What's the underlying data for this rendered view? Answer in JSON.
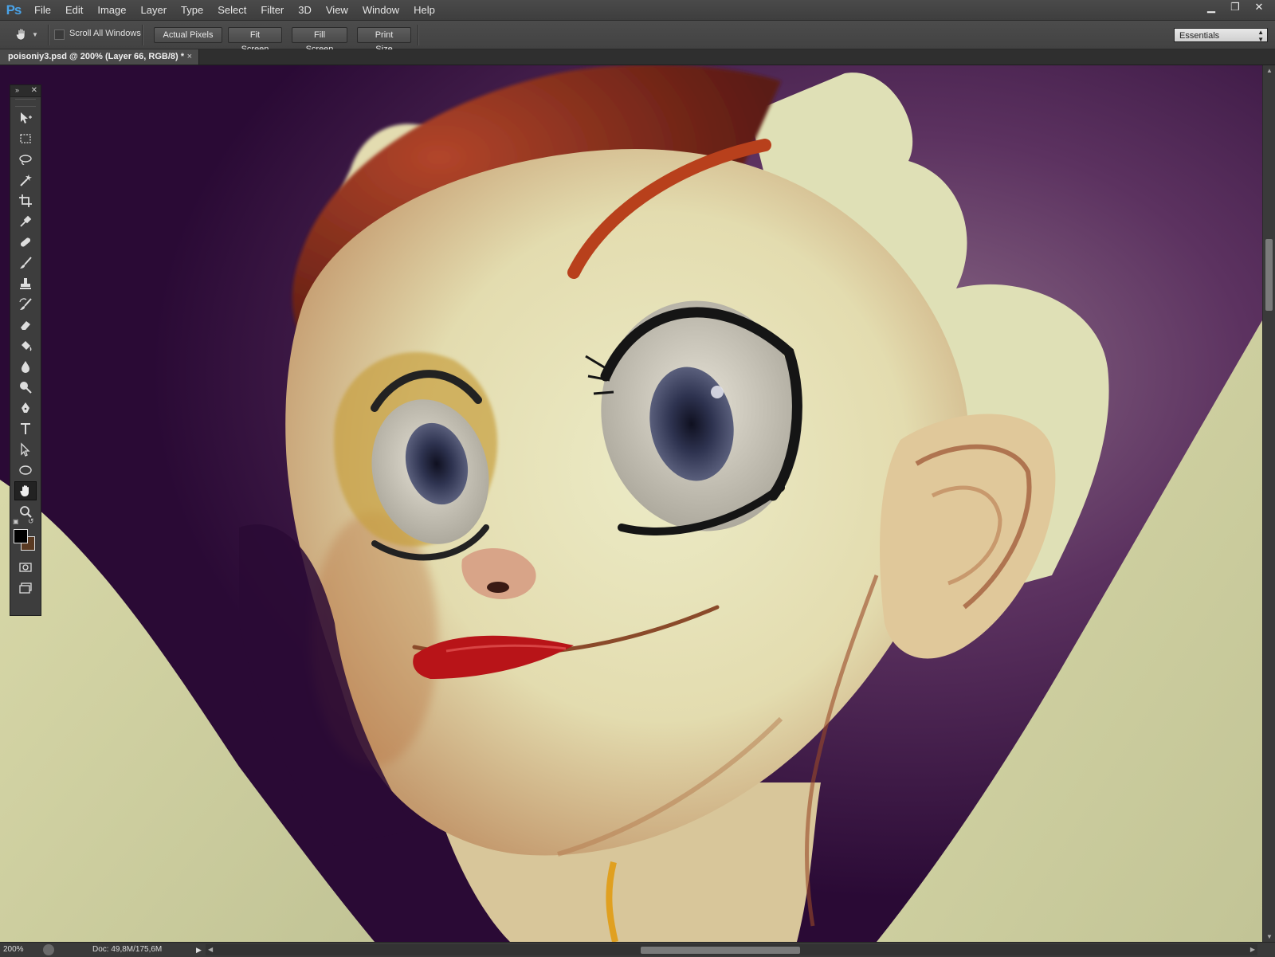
{
  "app": {
    "logo": "Ps",
    "menu": [
      "File",
      "Edit",
      "Image",
      "Layer",
      "Type",
      "Select",
      "Filter",
      "3D",
      "View",
      "Window",
      "Help"
    ],
    "window_controls": [
      "minimize-icon",
      "restore-icon",
      "close-icon"
    ]
  },
  "options_bar": {
    "tool_icon": "hand-icon",
    "scroll_all_windows_label": "Scroll All Windows",
    "scroll_all_windows_checked": false,
    "buttons": [
      "Actual Pixels",
      "Fit Screen",
      "Fill Screen",
      "Print Size"
    ],
    "workspace": "Essentials"
  },
  "document": {
    "tab_title": "poisoniy3.psd @ 200% (Layer 66, RGB/8) *",
    "tab_close": "×"
  },
  "tools": [
    {
      "name": "move-tool",
      "icon": "move-icon"
    },
    {
      "name": "rectangular-marquee-tool",
      "icon": "marquee-icon"
    },
    {
      "name": "lasso-tool",
      "icon": "lasso-icon"
    },
    {
      "name": "magic-wand-tool",
      "icon": "magic-wand-icon"
    },
    {
      "name": "crop-tool",
      "icon": "crop-icon"
    },
    {
      "name": "eyedropper-tool",
      "icon": "eyedropper-icon"
    },
    {
      "name": "healing-brush-tool",
      "icon": "bandage-icon"
    },
    {
      "name": "brush-tool",
      "icon": "brush-icon"
    },
    {
      "name": "clone-stamp-tool",
      "icon": "stamp-icon"
    },
    {
      "name": "history-brush-tool",
      "icon": "history-brush-icon"
    },
    {
      "name": "eraser-tool",
      "icon": "eraser-icon"
    },
    {
      "name": "paint-bucket-tool",
      "icon": "bucket-icon"
    },
    {
      "name": "blur-tool",
      "icon": "blur-icon"
    },
    {
      "name": "dodge-tool",
      "icon": "dodge-icon"
    },
    {
      "name": "pen-tool",
      "icon": "pen-icon"
    },
    {
      "name": "type-tool",
      "icon": "type-icon"
    },
    {
      "name": "path-selection-tool",
      "icon": "arrow-icon"
    },
    {
      "name": "ellipse-tool",
      "icon": "ellipse-icon"
    },
    {
      "name": "hand-tool",
      "icon": "hand-icon",
      "active": true
    },
    {
      "name": "zoom-tool",
      "icon": "zoom-icon"
    }
  ],
  "colors": {
    "foreground": "#000000",
    "background": "#5a3a22",
    "canvas_bg": "#2a0a35",
    "skin": "#e6e2b8",
    "hair": "#8b2a14",
    "lips": "#b81418",
    "iris": "#3a3e58"
  },
  "status": {
    "zoom": "200%",
    "doc_info": "Doc: 49,8M/175,6M"
  }
}
